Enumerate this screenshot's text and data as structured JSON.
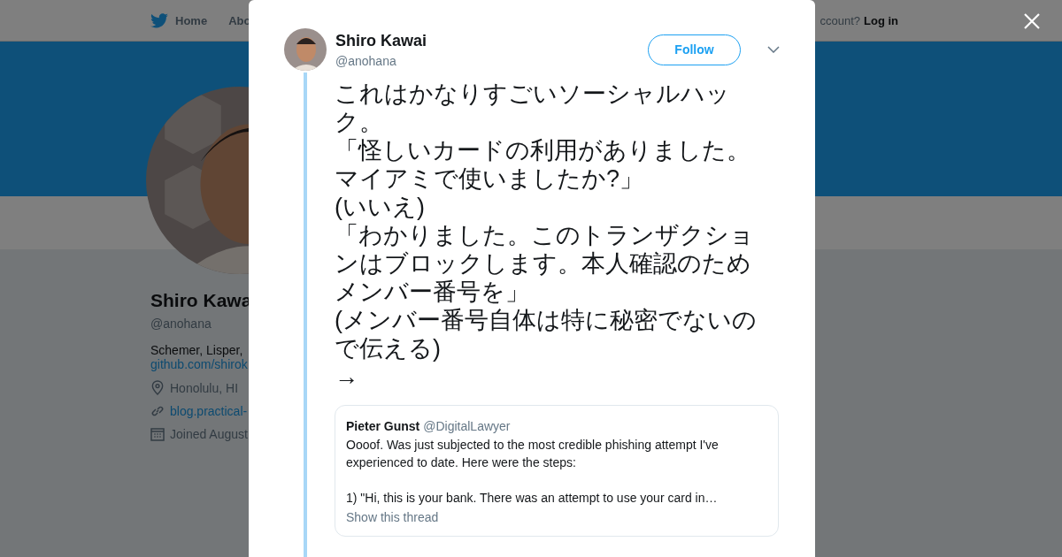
{
  "nav": {
    "items": [
      "Home",
      "Abo"
    ],
    "account_prompt": "ccount?",
    "login": "Log in"
  },
  "profile": {
    "name": "Shiro Kawa",
    "handle": "@anohana",
    "bio": "Schemer, Lisper, ",
    "bio_link": "github.com/shirok",
    "location": "Honolulu, HI",
    "website": "blog.practical-",
    "joined": "Joined August"
  },
  "modal": {
    "author": {
      "name": "Shiro Kawai",
      "handle": "@anohana"
    },
    "follow_button": "Follow",
    "tweet_lines": [
      "これはかなりすごいソーシャルハック。",
      "「怪しいカードの利用がありました。マイアミで使いましたか?」",
      "(いいえ)",
      "「わかりました。このトランザクションはブロックします。本人確認のためメンバー番号を」",
      "(メンバー番号自体は特に秘密でないので伝える)",
      "→"
    ],
    "quoted_tweet": {
      "name": "Pieter Gunst",
      "handle": "@DigitalLawyer",
      "text": "Oooof. Was just subjected to the most credible phishing attempt I've experienced to date. Here were the steps:\n\n1) \"Hi, this is your bank. There was an attempt to use your card in…",
      "link": "Show this thread"
    }
  }
}
